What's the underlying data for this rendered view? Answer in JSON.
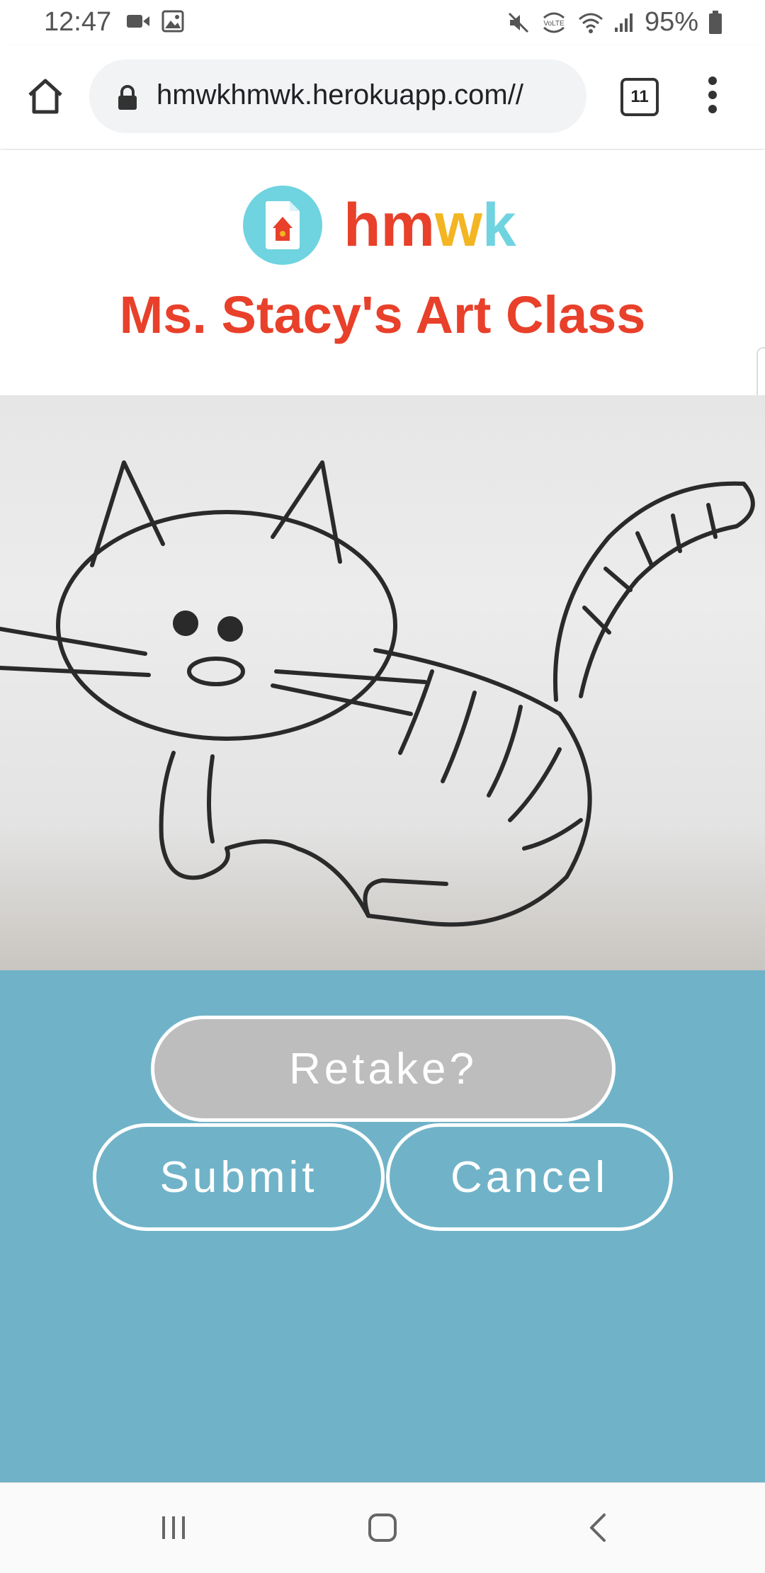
{
  "status_bar": {
    "time": "12:47",
    "left_icons": [
      "video-call-icon",
      "image-icon"
    ],
    "right_icons": [
      "mute-icon",
      "volte-icon",
      "wifi-icon",
      "signal-icon"
    ],
    "volte_label": "VoLTE",
    "battery_percent": "95%"
  },
  "browser": {
    "url": "hmwkhmwk.herokuapp.com//",
    "tab_count": "11"
  },
  "header": {
    "brand": {
      "h": "h",
      "m": "m",
      "w": "w",
      "k": "k"
    },
    "brand_colors": {
      "h": "#e8402a",
      "m": "#e8402a",
      "w": "#f3b521",
      "k": "#6fd3e0"
    },
    "class_title": "Ms. Stacy's Art Class"
  },
  "photo": {
    "subject": "cat-drawing"
  },
  "actions": {
    "retake_label": "Retake?",
    "submit_label": "Submit",
    "cancel_label": "Cancel"
  },
  "nav": {
    "items": [
      "recent-apps-icon",
      "home-icon",
      "back-icon"
    ]
  },
  "colors": {
    "accent_red": "#e8402a",
    "action_bg": "#70b3c8",
    "retake_bg": "#bdbdbd"
  }
}
